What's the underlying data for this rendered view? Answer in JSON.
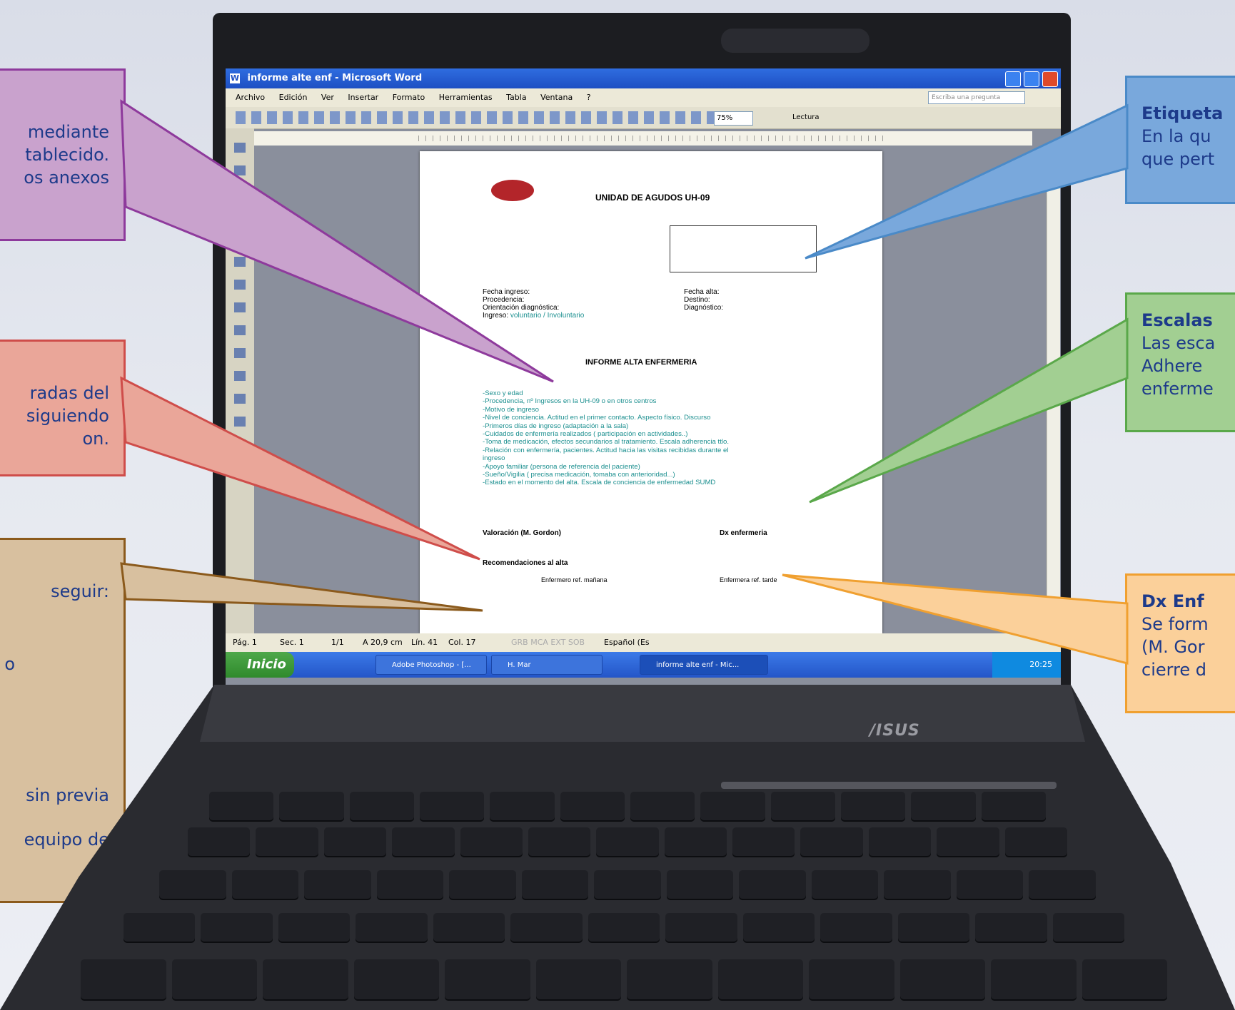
{
  "colors": {
    "purple": "#8e3a9c",
    "red": "#cf4d4a",
    "brown": "#8b5a1c",
    "blue": "#4a8ac8",
    "green": "#5aa84a",
    "orange": "#f0a030",
    "text_blue": "#1d3a8a"
  },
  "callouts": {
    "purple": {
      "lines": [
        "mediante",
        "tablecido.",
        "os anexos"
      ]
    },
    "red": {
      "lines": [
        "radas del",
        "siguiendo",
        "on."
      ]
    },
    "brown": {
      "lines": [
        "seguir:",
        "o",
        "sin previa",
        "equipo de"
      ]
    },
    "blue": {
      "title": "Etiqueta",
      "lines": [
        "En la qu",
        "que pert"
      ]
    },
    "green": {
      "title": "Escalas",
      "lines": [
        "Las esca",
        "Adhere",
        "enferme"
      ]
    },
    "orange": {
      "title": "Dx Enf",
      "lines": [
        "Se form",
        "(M. Gor",
        "cierre d"
      ]
    }
  },
  "word": {
    "window_title": "informe alte enf - Microsoft Word",
    "menu": [
      "Archivo",
      "Edición",
      "Ver",
      "Insertar",
      "Formato",
      "Herramientas",
      "Tabla",
      "Ventana",
      "?"
    ],
    "help_placeholder": "Escriba una pregunta",
    "zoom": "75%",
    "reading_button": "Lectura"
  },
  "document": {
    "header": "UNIDAD DE AGUDOS UH-09",
    "left_fields": [
      "Fecha ingreso:",
      "Procedencia:",
      "Orientación diagnóstica:"
    ],
    "ingreso_label": "Ingreso:",
    "ingreso_value": " voluntario / Involuntario",
    "right_fields": [
      "Fecha alta:",
      "Destino:",
      "Diagnóstico:"
    ],
    "section_title": "INFORME ALTA ENFERMERIA",
    "items": [
      "-Sexo y edad",
      "-Procedencia, nº Ingresos en la UH-09 o en otros centros",
      "-Motivo de ingreso",
      "-Nivel de conciencia. Actitud en el primer contacto. Aspecto físico. Discurso",
      "-Primeros días de ingreso (adaptación a la sala)",
      "-Cuidados de enfermería realizados ( participación en actividades..)",
      "-Toma de medicación, efectos secundarios al tratamiento. Escala adherencia ttlo.",
      "-Relación con enfermería, pacientes. Actitud hacia las visitas recibidas durante el",
      "ingreso",
      "-Apoyo familiar (persona de referencia del paciente)",
      "-Sueño/Vigilia ( precisa medicación, tomaba con anterioridad...)",
      "-Estado en el momento del alta. Escala de conciencia de enfermedad SUMD"
    ],
    "valoracion": "Valoración (M. Gordon)",
    "dx": "Dx enfermeria",
    "recomendaciones": "Recomendaciones  al alta",
    "enfermero_manana": "Enfermero ref. mañana",
    "enfermera_tarde": "Enfermera ref. tarde"
  },
  "status": {
    "page": "Pág. 1",
    "sec": "Sec. 1",
    "count": "1/1",
    "pos": "A 20,9 cm",
    "line": "Lín. 41",
    "col": "Col. 17",
    "modes": "GRB  MCA  EXT  SOB",
    "lang": "Español (Es"
  },
  "taskbar": {
    "start": "Inicio",
    "tasks": [
      "Adobe Photoshop - [...",
      "H. Mar",
      "informe alte enf - Mic..."
    ],
    "clock": "20:25"
  },
  "brand": "/ISUS"
}
